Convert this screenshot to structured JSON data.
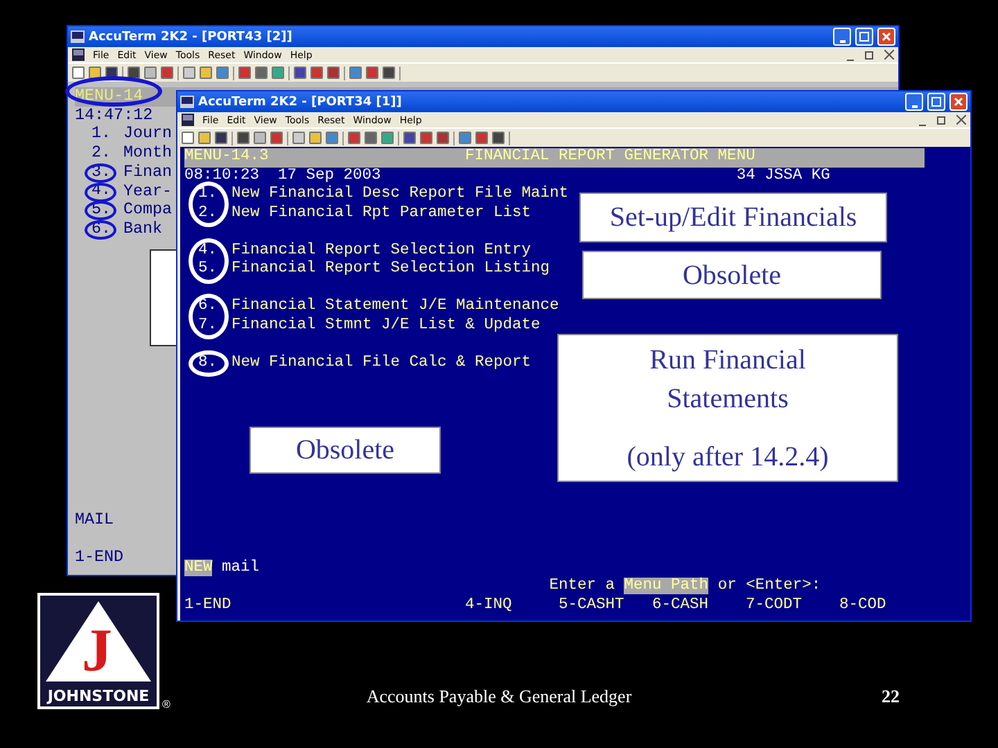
{
  "back_window": {
    "title": "AccuTerm 2K2 - [PORT43 [2]]",
    "menu": [
      "File",
      "Edit",
      "View",
      "Tools",
      "Reset",
      "Window",
      "Help"
    ],
    "terminal": {
      "menu_code": "MENU-14",
      "time": "14:47:12",
      "items": [
        {
          "number": "1.",
          "label": "Journ"
        },
        {
          "number": "2.",
          "label": "Month"
        },
        {
          "number": "3.",
          "label": "Finan"
        },
        {
          "number": "4.",
          "label": "Year-"
        },
        {
          "number": "5.",
          "label": "Compa"
        },
        {
          "number": "6.",
          "label": "Bank"
        }
      ],
      "mail": "MAIL",
      "function_keys": [
        "1-END"
      ]
    }
  },
  "front_window": {
    "title": "AccuTerm 2K2 - [PORT34 [1]]",
    "menu": [
      "File",
      "Edit",
      "View",
      "Tools",
      "Reset",
      "Window",
      "Help"
    ],
    "terminal": {
      "menu_code": "MENU-14.3",
      "heading": "FINANCIAL REPORT GENERATOR MENU",
      "timestamp": "08:10:23  17 Sep 2003",
      "user_info": "34 JSSA KG",
      "item_groups": [
        [
          {
            "number": "1.",
            "label": "New Financial Desc Report File Maint"
          },
          {
            "number": "2.",
            "label": "New Financial Rpt Parameter List"
          }
        ],
        [
          {
            "number": "4.",
            "label": "Financial Report Selection Entry"
          },
          {
            "number": "5.",
            "label": "Financial Report Selection Listing"
          }
        ],
        [
          {
            "number": "6.",
            "label": "Financial Statement J/E Maintenance"
          },
          {
            "number": "7.",
            "label": "Financial Stmnt J/E List & Update"
          }
        ],
        [
          {
            "number": "8.",
            "label": "New Financial File Calc & Report"
          }
        ]
      ],
      "mail_notice": {
        "flag": "NEW",
        "text": "mail"
      },
      "prompt": [
        {
          "text": "Enter a ",
          "highlighted": false
        },
        {
          "text": "Menu Path",
          "highlighted": true
        },
        {
          "text": " or <Enter>:",
          "highlighted": false
        }
      ],
      "function_keys": [
        "1-END",
        "4-INQ",
        "5-CASHT",
        "6-CASH",
        "7-CODT",
        "8-COD"
      ]
    }
  },
  "callouts": [
    {
      "lines": [
        "Set-up/Edit Financials"
      ]
    },
    {
      "lines": [
        "Obsolete"
      ]
    },
    {
      "lines": [
        "Obsolete"
      ]
    },
    {
      "lines": [
        "Run Financial",
        "Statements",
        "(only after 14.2.4)"
      ]
    }
  ],
  "logo": {
    "letter": "J",
    "name": "JOHNSTONE",
    "mark": "®"
  },
  "footer": {
    "title": "Accounts Payable & General Ledger",
    "page": "22"
  }
}
